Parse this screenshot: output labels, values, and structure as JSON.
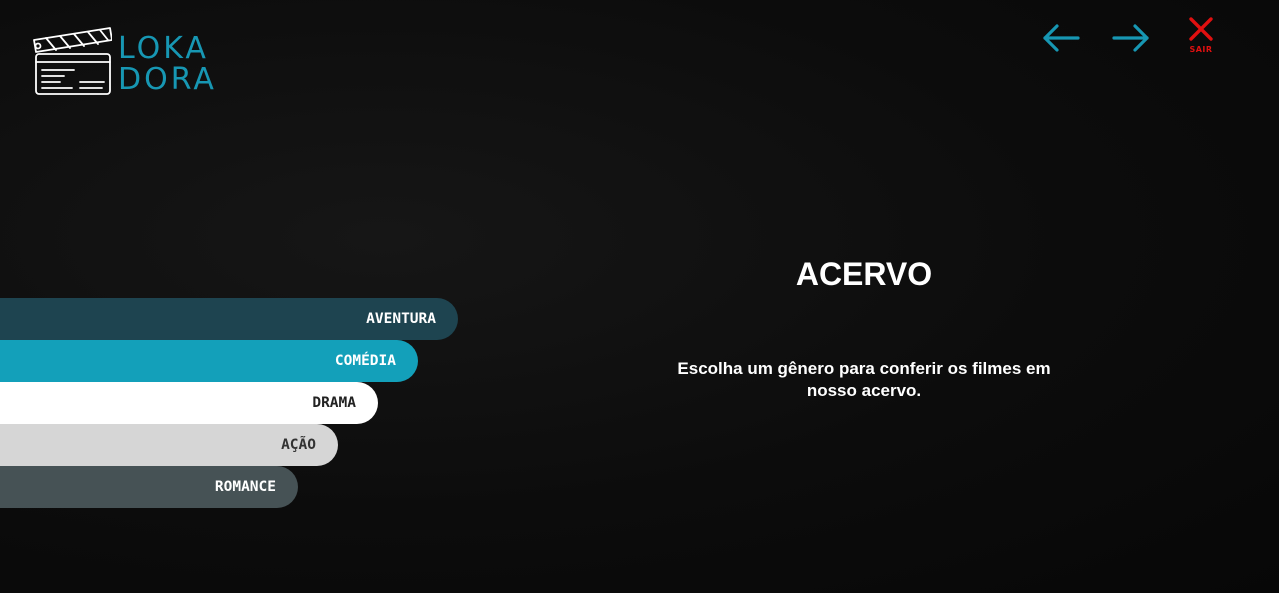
{
  "logo": {
    "line1": "LOKA",
    "line2": "DORA",
    "icon": "clapperboard-icon",
    "color": "#1797b3"
  },
  "nav": {
    "back_icon": "arrow-left-icon",
    "forward_icon": "arrow-right-icon",
    "exit_icon": "close-icon",
    "exit_label": "SAIR",
    "arrow_color": "#1797b3",
    "exit_color": "#e01010"
  },
  "genres": [
    {
      "label": "AVENTURA",
      "color": "#1e4450"
    },
    {
      "label": "COMÉDIA",
      "color": "#13a0ba"
    },
    {
      "label": "DRAMA",
      "color": "#ffffff"
    },
    {
      "label": "AÇÃO",
      "color": "#d6d6d6"
    },
    {
      "label": "ROMANCE",
      "color": "#465255"
    }
  ],
  "main": {
    "title": "ACERVO",
    "description": "Escolha um gênero para conferir os filmes em nosso acervo."
  }
}
